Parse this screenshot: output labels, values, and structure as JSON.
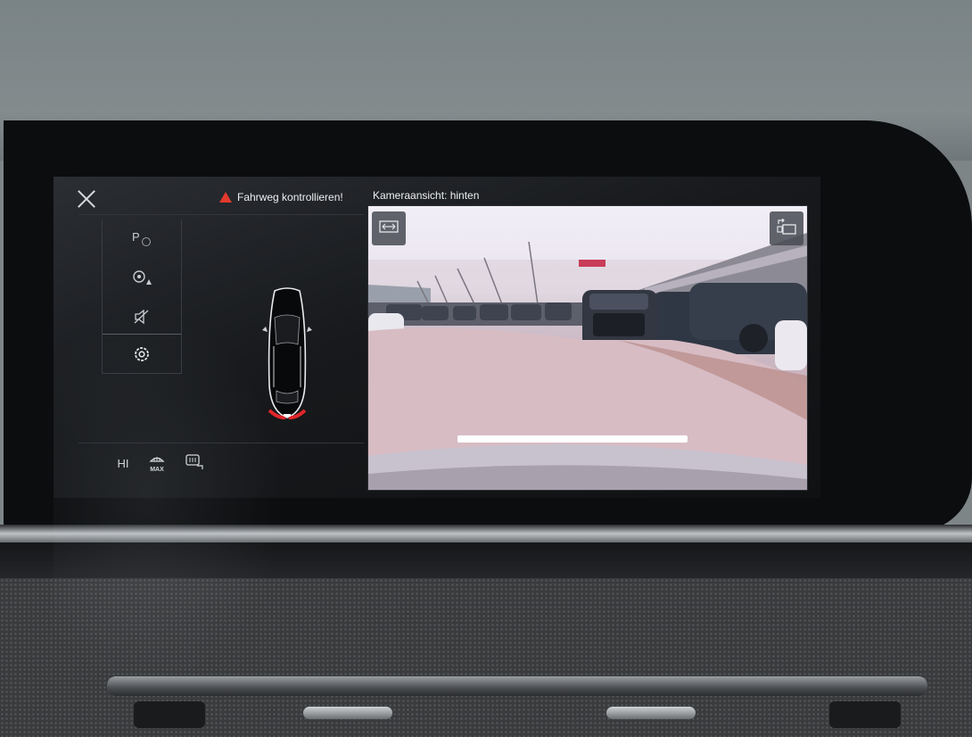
{
  "header": {
    "warning_text": "Fahrweg kontrollieren!",
    "camera_label": "Kameraansicht: hinten"
  },
  "side_menu": {
    "items": [
      {
        "icon": "parking-assist-icon",
        "label": "P"
      },
      {
        "icon": "park-steering-assist-icon",
        "label": ""
      },
      {
        "icon": "mute-icon",
        "label": ""
      },
      {
        "icon": "settings-gear-icon",
        "label": ""
      }
    ]
  },
  "climate": {
    "hi_label": "HI",
    "defrost_label": "MAX"
  },
  "colors": {
    "warning": "#e23a2e",
    "screen_bg": "#111214",
    "guide_line": "#ffffff"
  }
}
